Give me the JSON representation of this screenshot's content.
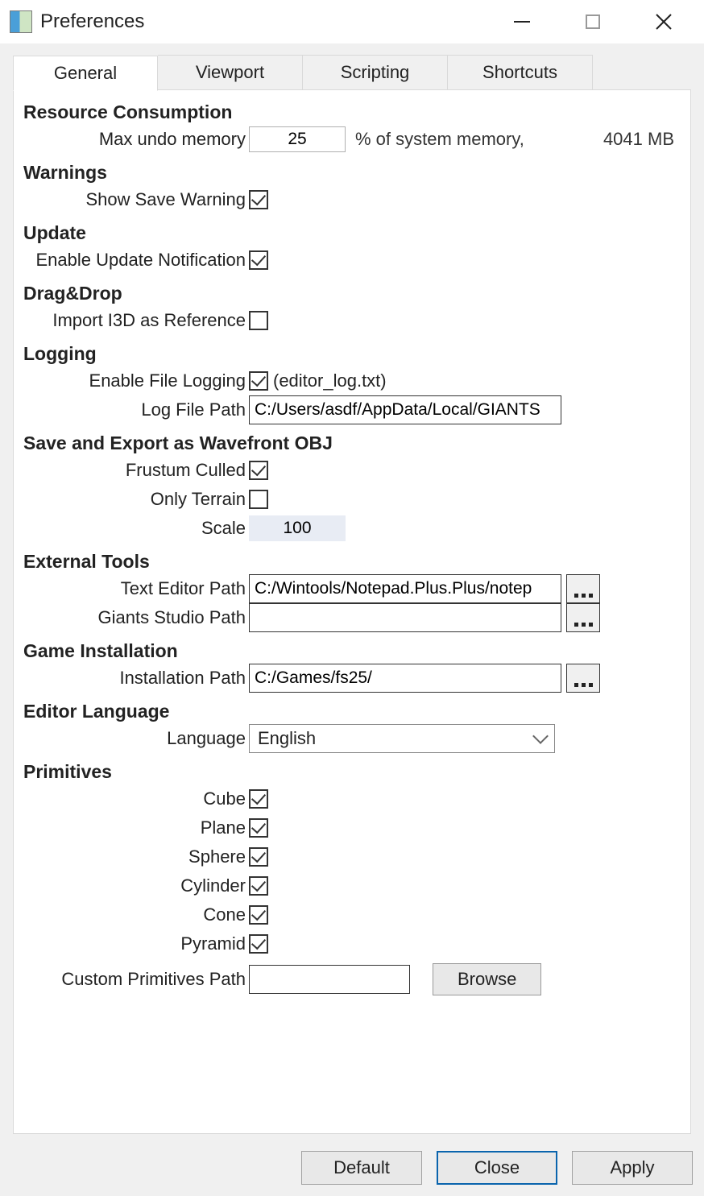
{
  "window": {
    "title": "Preferences"
  },
  "tabs": {
    "general": "General",
    "viewport": "Viewport",
    "scripting": "Scripting",
    "shortcuts": "Shortcuts"
  },
  "sections": {
    "resource": {
      "heading": "Resource Consumption",
      "max_undo_label": "Max undo memory",
      "max_undo_value": "25",
      "suffix": "% of system memory,",
      "total_mem": "4041 MB"
    },
    "warnings": {
      "heading": "Warnings",
      "show_save_label": "Show Save Warning"
    },
    "update": {
      "heading": "Update",
      "enable_update_label": "Enable Update Notification"
    },
    "dragdrop": {
      "heading": "Drag&Drop",
      "import_i3d_label": "Import I3D as Reference"
    },
    "logging": {
      "heading": "Logging",
      "enable_file_logging_label": "Enable File Logging",
      "enable_file_logging_hint": "(editor_log.txt)",
      "log_file_path_label": "Log File Path",
      "log_file_path_value": "C:/Users/asdf/AppData/Local/GIANTS"
    },
    "save_export": {
      "heading": "Save and Export as Wavefront OBJ",
      "frustum_label": "Frustum Culled",
      "only_terrain_label": "Only Terrain",
      "scale_label": "Scale",
      "scale_value": "100"
    },
    "external_tools": {
      "heading": "External Tools",
      "text_editor_label": "Text Editor Path",
      "text_editor_value": "C:/Wintools/Notepad.Plus.Plus/notep",
      "giants_studio_label": "Giants Studio Path",
      "giants_studio_value": ""
    },
    "game_install": {
      "heading": "Game Installation",
      "install_path_label": "Installation Path",
      "install_path_value": "C:/Games/fs25/"
    },
    "editor_lang": {
      "heading": "Editor Language",
      "language_label": "Language",
      "language_value": "English"
    },
    "primitives": {
      "heading": "Primitives",
      "cube": "Cube",
      "plane": "Plane",
      "sphere": "Sphere",
      "cylinder": "Cylinder",
      "cone": "Cone",
      "pyramid": "Pyramid",
      "custom_path_label": "Custom Primitives Path",
      "custom_path_value": "",
      "browse": "Browse"
    }
  },
  "footer": {
    "default": "Default",
    "close": "Close",
    "apply": "Apply"
  }
}
